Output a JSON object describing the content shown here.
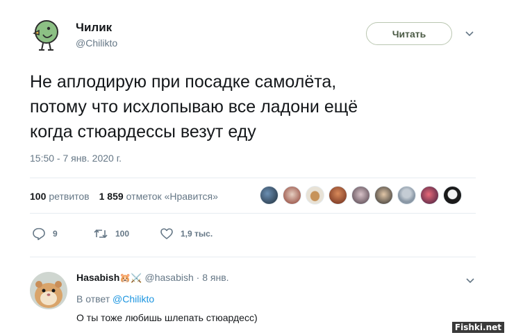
{
  "tweet": {
    "author_name": "Чилик",
    "author_handle": "@Chilikto",
    "follow_label": "Читать",
    "text_line1": "Не аплодирую при посадке самолёта,",
    "text_line2": "потому что исхлопываю все ладони ещё",
    "text_line3": "когда стюардессы везут еду",
    "timestamp": "15:50 - 7 янв. 2020 г."
  },
  "stats": {
    "retweets_count": "100",
    "retweets_label": "ретвитов",
    "likes_count": "1 859",
    "likes_label": "отметок «Нравится»"
  },
  "actions": {
    "replies": "9",
    "retweets": "100",
    "likes": "1,9 тыс."
  },
  "reply": {
    "name": "Hasabish",
    "emoji": "🐹⚔️",
    "handle": "@hasabish",
    "separator": "·",
    "date": "8 янв.",
    "reply_to_prefix": "В ответ",
    "reply_to_handle": "@Chilikto",
    "text": "О ты тоже любишь шлепать стюардесс)"
  },
  "watermark": "Fishki.net",
  "colors": {
    "accent": "#1b95e0",
    "follow_border": "#b9c6b0",
    "muted": "#657786"
  },
  "icons": {
    "more": "chevron-down-icon",
    "reply": "speech-bubble-icon",
    "retweet": "retweet-icon",
    "like": "heart-icon"
  }
}
